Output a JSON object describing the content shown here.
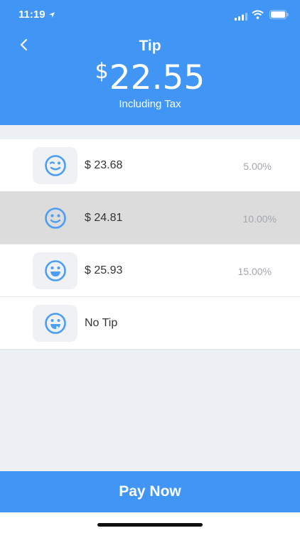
{
  "status": {
    "time": "11:19",
    "location_icon": "location-arrow-icon",
    "signal_icon": "cellular-signal-icon",
    "wifi_icon": "wifi-icon",
    "battery_icon": "battery-icon"
  },
  "header": {
    "back_icon": "chevron-left-icon",
    "title": "Tip",
    "currency": "$",
    "amount": "22.55",
    "subtitle": "Including Tax"
  },
  "options": [
    {
      "icon": "wink-face-icon",
      "amount": "$ 23.68",
      "percent": "5.00%",
      "selected": false
    },
    {
      "icon": "smile-face-icon",
      "amount": "$ 24.81",
      "percent": "10.00%",
      "selected": true
    },
    {
      "icon": "grin-face-icon",
      "amount": "$ 25.93",
      "percent": "15.00%",
      "selected": false
    },
    {
      "icon": "tongue-face-icon",
      "amount": "No Tip",
      "percent": "",
      "selected": false
    }
  ],
  "footer": {
    "pay_label": "Pay Now"
  },
  "colors": {
    "primary": "#4095f5",
    "selected_row": "#dcdcdc",
    "icon_blue": "#4a9ef5"
  }
}
